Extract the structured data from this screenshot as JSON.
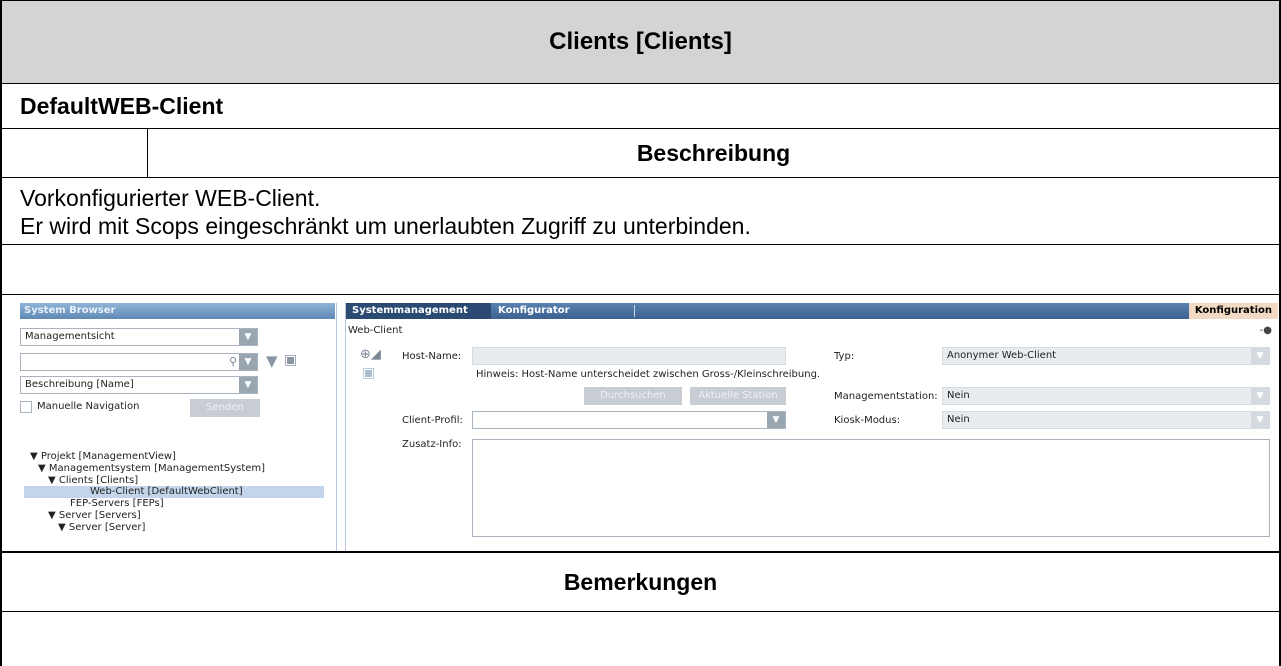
{
  "document": {
    "title": "Clients [Clients]",
    "client_name": "DefaultWEB-Client",
    "description_header": "Beschreibung",
    "description_lines": [
      "Vorkonfigurierter WEB-Client.",
      "Er wird mit Scops eingeschränkt um unerlaubten Zugriff zu unterbinden."
    ],
    "remarks_header": "Bemerkungen"
  },
  "screenshot": {
    "system_browser": {
      "title": "System Browser",
      "view_select": "Managementsicht",
      "search_value": "",
      "sort_select": "Beschreibung [Name]",
      "manual_nav_label": "Manuelle Navigation",
      "send_button": "Senden",
      "tree": [
        {
          "label": "▼ Projekt [ManagementView]",
          "indent": 0,
          "selected": false
        },
        {
          "label": "▼ Managementsystem [ManagementSystem]",
          "indent": 1,
          "selected": false
        },
        {
          "label": "▼ Clients [Clients]",
          "indent": 2,
          "selected": false
        },
        {
          "label": "Web-Client [DefaultWebClient]",
          "indent": 4,
          "selected": true
        },
        {
          "label": "FEP-Servers [FEPs]",
          "indent": 3,
          "selected": false
        },
        {
          "label": "▼ Server [Servers]",
          "indent": 2,
          "selected": false
        },
        {
          "label": "▼ Server [Server]",
          "indent": 3,
          "selected": false
        }
      ]
    },
    "tabs": [
      "Systemmanagement",
      "Konfigurator"
    ],
    "right_tab": "Konfiguration",
    "panel_title": "Web-Client",
    "form": {
      "host_name_label": "Host-Name:",
      "host_name_value": "",
      "host_hint": "Hinweis: Host-Name unterscheidet zwischen Gross-/Kleinschreibung.",
      "browse_button": "Durchsuchen",
      "current_station_button": "Aktuelle Station",
      "client_profile_label": "Client-Profil:",
      "client_profile_value": "",
      "extra_info_label": "Zusatz-Info:",
      "extra_info_value": "",
      "type_label": "Typ:",
      "type_value": "Anonymer Web-Client",
      "mgmt_station_label": "Managementstation:",
      "mgmt_station_value": "Nein",
      "kiosk_label": "Kiosk-Modus:",
      "kiosk_value": "Nein"
    }
  }
}
